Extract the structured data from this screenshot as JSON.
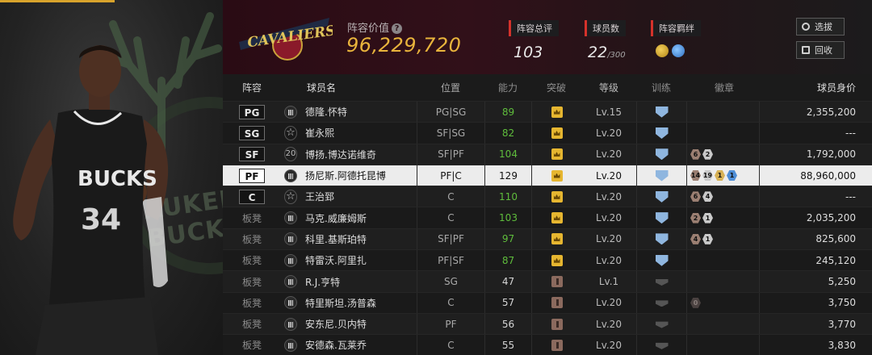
{
  "header": {
    "team_logo_text": "CAVALIERS",
    "value_label": "阵容价值",
    "value": "96,229,720",
    "stats": [
      {
        "label": "阵容总评",
        "value": "103",
        "sub": ""
      },
      {
        "label": "球员数",
        "value": "22",
        "sub": "/300"
      },
      {
        "label": "阵容羁绊",
        "value": "",
        "sub": ""
      }
    ],
    "buttons": {
      "select": "选拔",
      "recycle": "回收"
    }
  },
  "table": {
    "headers": {
      "lineup": "阵容",
      "name": "球员名",
      "slot": "位置",
      "rating": "能力",
      "breakthrough": "突破",
      "level": "等级",
      "training": "训练",
      "badges": "徽章",
      "price": "球员身价"
    },
    "rows": [
      {
        "pos": "PG",
        "starter": true,
        "icon": "bars",
        "name": "德隆.怀特",
        "slot": "PG|SG",
        "rating": "89",
        "rating_color": "green",
        "crown": "gold",
        "level": "Lv.15",
        "training": "blue",
        "badges": [],
        "price": "2,355,200"
      },
      {
        "pos": "SG",
        "starter": true,
        "icon": "star",
        "name": "崔永熙",
        "slot": "SF|SG",
        "rating": "82",
        "rating_color": "green",
        "crown": "gold",
        "level": "Lv.20",
        "training": "blue",
        "badges": [],
        "price": "---"
      },
      {
        "pos": "SF",
        "starter": true,
        "icon": "20",
        "name": "博扬.博达诺维奇",
        "slot": "SF|PF",
        "rating": "104",
        "rating_color": "green",
        "crown": "gold",
        "level": "Lv.20",
        "training": "blue",
        "badges": [
          {
            "n": "6",
            "t": "bronze"
          },
          {
            "n": "2",
            "t": "silver"
          }
        ],
        "price": "1,792,000"
      },
      {
        "pos": "PF",
        "starter": true,
        "selected": true,
        "icon": "bars",
        "name": "扬尼斯.阿德托昆博",
        "slot": "PF|C",
        "rating": "129",
        "rating_color": "white",
        "crown": "gold",
        "level": "Lv.20",
        "training": "blue",
        "badges": [
          {
            "n": "14",
            "t": "bronze"
          },
          {
            "n": "19",
            "t": "silver"
          },
          {
            "n": "1",
            "t": "gold"
          },
          {
            "n": "1",
            "t": "blue"
          }
        ],
        "price": "88,960,000"
      },
      {
        "pos": "C",
        "starter": true,
        "icon": "star",
        "name": "王治郅",
        "slot": "C",
        "rating": "110",
        "rating_color": "green",
        "crown": "gold",
        "level": "Lv.20",
        "training": "blue",
        "badges": [
          {
            "n": "6",
            "t": "bronze"
          },
          {
            "n": "4",
            "t": "silver"
          }
        ],
        "price": "---"
      },
      {
        "pos": "板凳",
        "starter": false,
        "icon": "bars",
        "name": "马克.威廉姆斯",
        "slot": "C",
        "rating": "103",
        "rating_color": "green",
        "crown": "gold",
        "level": "Lv.20",
        "training": "blue",
        "badges": [
          {
            "n": "2",
            "t": "bronze"
          },
          {
            "n": "1",
            "t": "silver"
          }
        ],
        "price": "2,035,200"
      },
      {
        "pos": "板凳",
        "starter": false,
        "icon": "bars",
        "name": "科里.基斯珀特",
        "slot": "SF|PF",
        "rating": "97",
        "rating_color": "green",
        "crown": "gold",
        "level": "Lv.20",
        "training": "blue",
        "badges": [
          {
            "n": "4",
            "t": "bronze"
          },
          {
            "n": "1",
            "t": "silver"
          }
        ],
        "price": "825,600"
      },
      {
        "pos": "板凳",
        "starter": false,
        "icon": "bars",
        "name": "特雷沃.阿里扎",
        "slot": "PF|SF",
        "rating": "87",
        "rating_color": "green",
        "crown": "gold",
        "level": "Lv.20",
        "training": "blue",
        "badges": [],
        "price": "245,120"
      },
      {
        "pos": "板凳",
        "starter": false,
        "icon": "bars",
        "name": "R.J.亨特",
        "slot": "SG",
        "rating": "47",
        "rating_color": "white",
        "crown": "bronze",
        "level": "Lv.1",
        "training": "gray",
        "badges": [],
        "price": "5,250"
      },
      {
        "pos": "板凳",
        "starter": false,
        "icon": "bars",
        "name": "特里斯坦.汤普森",
        "slot": "C",
        "rating": "57",
        "rating_color": "white",
        "crown": "bronze",
        "level": "Lv.20",
        "training": "gray",
        "badges": [
          {
            "n": "0",
            "t": "dark"
          }
        ],
        "price": "3,750"
      },
      {
        "pos": "板凳",
        "starter": false,
        "icon": "bars",
        "name": "安东尼.贝内特",
        "slot": "PF",
        "rating": "56",
        "rating_color": "white",
        "crown": "bronze",
        "level": "Lv.20",
        "training": "gray",
        "badges": [],
        "price": "3,770"
      },
      {
        "pos": "板凳",
        "starter": false,
        "icon": "bars",
        "name": "安德森.瓦莱乔",
        "slot": "C",
        "rating": "55",
        "rating_color": "white",
        "crown": "bronze",
        "level": "Lv.20",
        "training": "gray",
        "badges": [],
        "price": "3,830"
      }
    ]
  },
  "player_panel": {
    "jersey_text": "BUCKS",
    "jersey_number": "34",
    "bg_text": "AUKEE BUCKS"
  },
  "colors": {
    "accent_gold": "#e9b43c",
    "rating_green": "#5fbd3c",
    "stat_red": "#d4322b",
    "training_blue": "#8fb6df"
  }
}
